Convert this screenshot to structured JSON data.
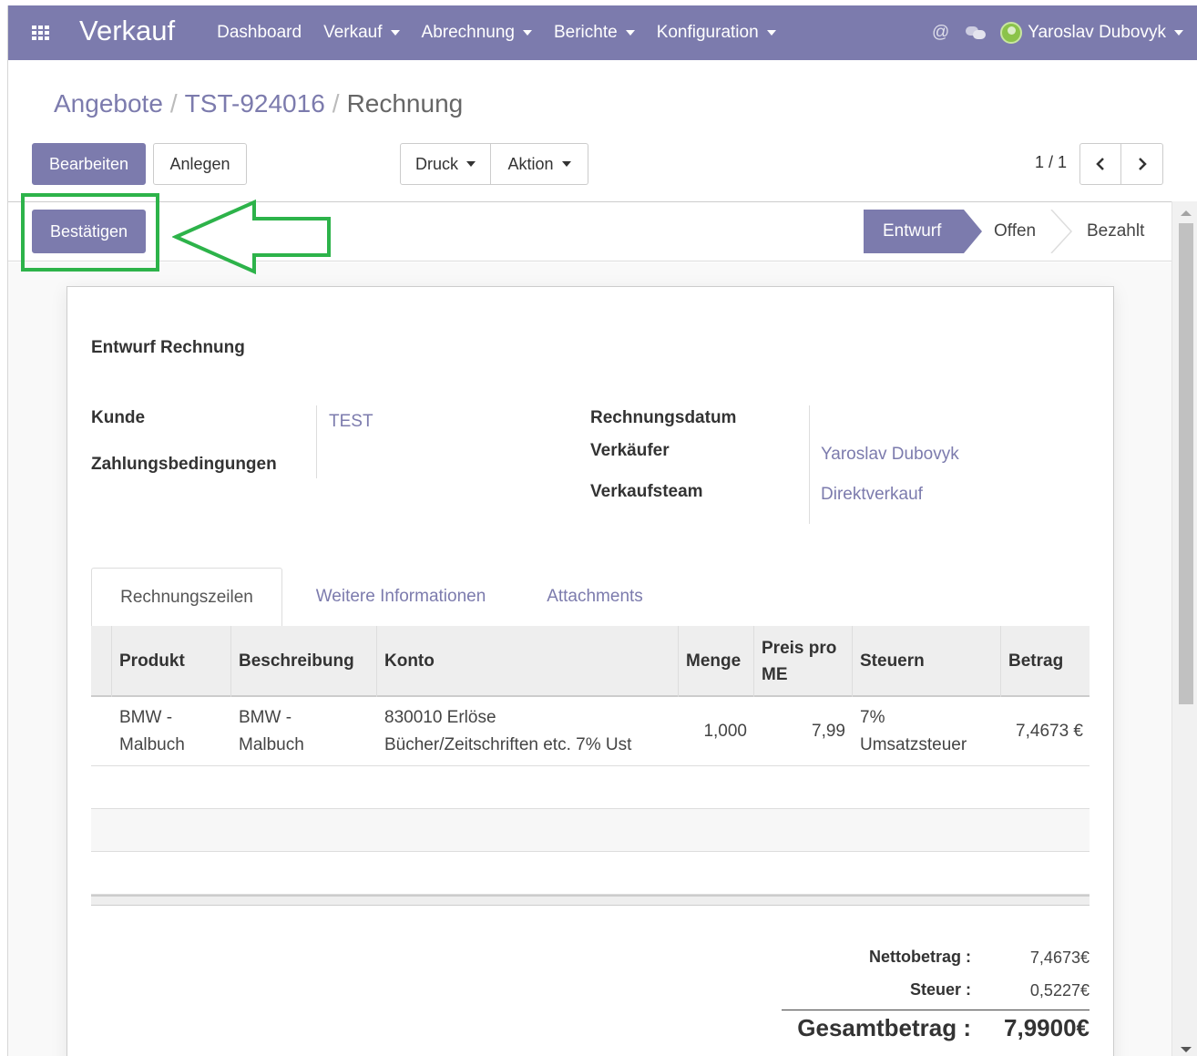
{
  "navbar": {
    "brand": "Verkauf",
    "menu": [
      {
        "label": "Dashboard",
        "dropdown": false
      },
      {
        "label": "Verkauf",
        "dropdown": true
      },
      {
        "label": "Abrechnung",
        "dropdown": true
      },
      {
        "label": "Berichte",
        "dropdown": true
      },
      {
        "label": "Konfiguration",
        "dropdown": true
      }
    ],
    "mentions_symbol": "@",
    "user": "Yaroslav Dubovyk"
  },
  "breadcrumb": {
    "items": [
      "Angebote",
      "TST-924016"
    ],
    "current": "Rechnung",
    "separator": "/"
  },
  "toolbar": {
    "edit_label": "Bearbeiten",
    "create_label": "Anlegen",
    "print_label": "Druck",
    "action_label": "Aktion",
    "pager": "1 / 1"
  },
  "statusbar": {
    "confirm_label": "Bestätigen",
    "stages": [
      "Entwurf",
      "Offen",
      "Bezahlt"
    ],
    "active_stage": "Entwurf"
  },
  "sheet": {
    "title": "Entwurf Rechnung",
    "customer_label": "Kunde",
    "customer_value": "TEST",
    "payment_terms_label": "Zahlungsbedingungen",
    "invoice_date_label": "Rechnungsdatum",
    "salesperson_label": "Verkäufer",
    "salesperson_value": "Yaroslav Dubovyk",
    "sales_team_label": "Verkaufsteam",
    "sales_team_value": "Direktverkauf"
  },
  "tabs": [
    "Rechnungszeilen",
    "Weitere Informationen",
    "Attachments"
  ],
  "table": {
    "headers": {
      "product": "Produkt",
      "description": "Beschreibung",
      "account": "Konto",
      "quantity": "Menge",
      "price_line1": "Preis pro",
      "price_line2": "ME",
      "taxes": "Steuern",
      "amount": "Betrag"
    },
    "rows": [
      {
        "product_line1": "BMW -",
        "product_line2": "Malbuch",
        "description_line1": "BMW -",
        "description_line2": "Malbuch",
        "account_line1": "830010 Erlöse",
        "account_line2": "Bücher/Zeitschriften etc. 7% Ust",
        "quantity": "1,000",
        "price": "7,99",
        "taxes_line1": "7%",
        "taxes_line2": "Umsatzsteuer",
        "amount": "7,4673 €"
      }
    ]
  },
  "totals": {
    "net_label": "Nettobetrag :",
    "net_value": "7,4673€",
    "tax_label": "Steuer :",
    "tax_value": "0,5227€",
    "total_label": "Gesamtbetrag :",
    "total_value": "7,9900€"
  },
  "colors": {
    "brand": "#7c7bad",
    "highlight": "#2db34a"
  }
}
